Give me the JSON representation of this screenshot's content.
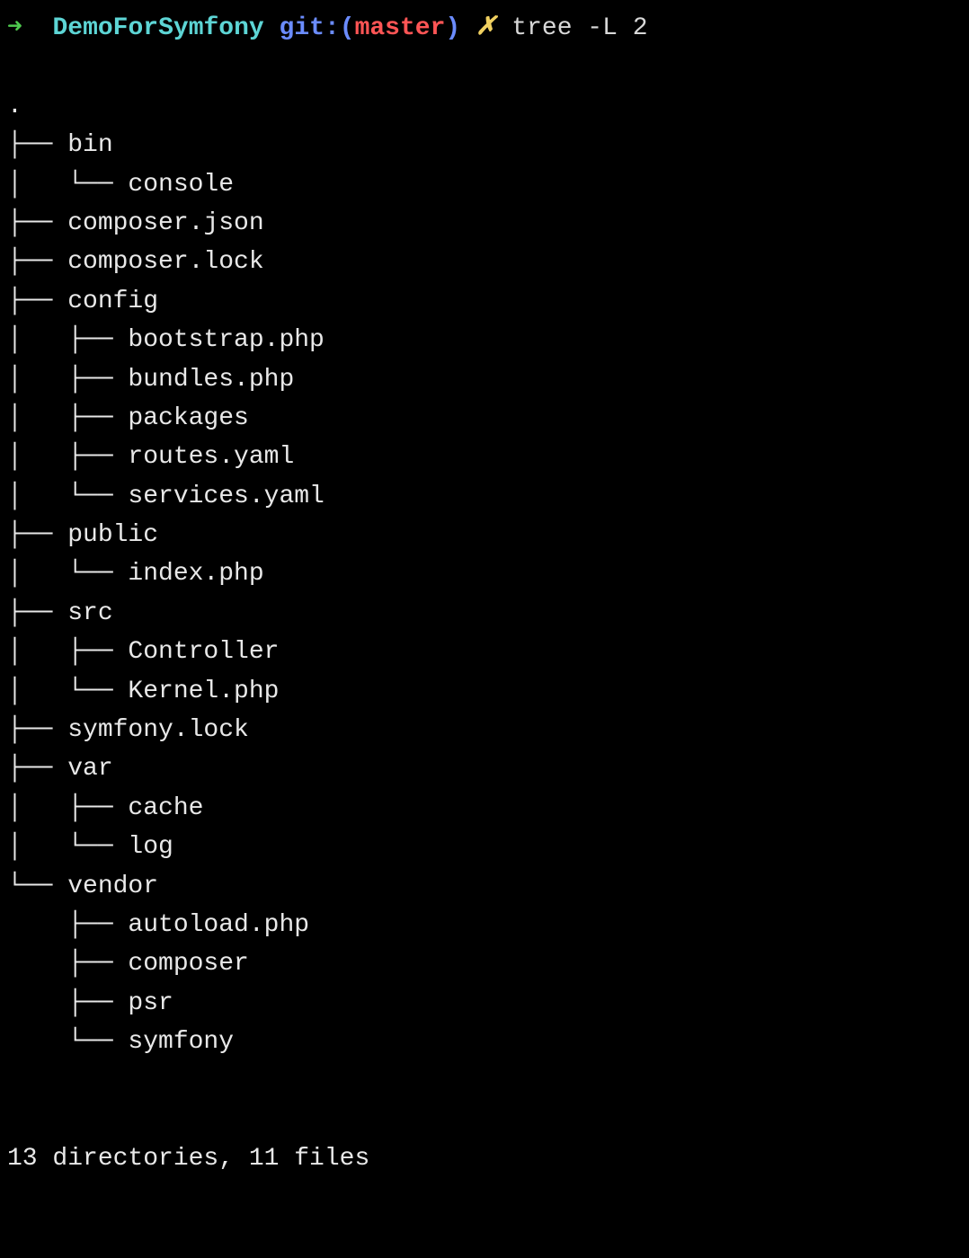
{
  "prompt": {
    "arrow": "➜",
    "cwd": "DemoForSymfony",
    "git_label": "git:",
    "branch": "master",
    "dirty_marker": "✗",
    "command": "tree -L 2"
  },
  "tree": {
    "root": ".",
    "lines": [
      {
        "prefix": "├── ",
        "name": "bin"
      },
      {
        "prefix": "│   └── ",
        "name": "console"
      },
      {
        "prefix": "├── ",
        "name": "composer.json"
      },
      {
        "prefix": "├── ",
        "name": "composer.lock"
      },
      {
        "prefix": "├── ",
        "name": "config"
      },
      {
        "prefix": "│   ├── ",
        "name": "bootstrap.php"
      },
      {
        "prefix": "│   ├── ",
        "name": "bundles.php"
      },
      {
        "prefix": "│   ├── ",
        "name": "packages"
      },
      {
        "prefix": "│   ├── ",
        "name": "routes.yaml"
      },
      {
        "prefix": "│   └── ",
        "name": "services.yaml"
      },
      {
        "prefix": "├── ",
        "name": "public"
      },
      {
        "prefix": "│   └── ",
        "name": "index.php"
      },
      {
        "prefix": "├── ",
        "name": "src"
      },
      {
        "prefix": "│   ├── ",
        "name": "Controller"
      },
      {
        "prefix": "│   └── ",
        "name": "Kernel.php"
      },
      {
        "prefix": "├── ",
        "name": "symfony.lock"
      },
      {
        "prefix": "├── ",
        "name": "var"
      },
      {
        "prefix": "│   ├── ",
        "name": "cache"
      },
      {
        "prefix": "│   └── ",
        "name": "log"
      },
      {
        "prefix": "└── ",
        "name": "vendor"
      },
      {
        "prefix": "    ├── ",
        "name": "autoload.php"
      },
      {
        "prefix": "    ├── ",
        "name": "composer"
      },
      {
        "prefix": "    ├── ",
        "name": "psr"
      },
      {
        "prefix": "    └── ",
        "name": "symfony"
      }
    ]
  },
  "summary": "13 directories, 11 files"
}
